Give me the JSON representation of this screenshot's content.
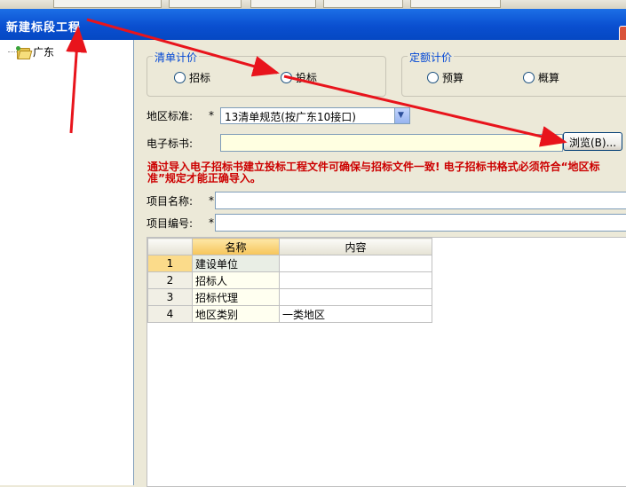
{
  "window": {
    "title": "新建标段工程"
  },
  "tree": {
    "root_label": "广东"
  },
  "pricing_group": {
    "label": "清单计价",
    "options": [
      "招标",
      "投标"
    ]
  },
  "quota_group": {
    "label": "定额计价",
    "options": [
      "预算",
      "概算"
    ]
  },
  "form": {
    "region_label": "地区标准:",
    "region_value": "13清单规范(按广东10接口)",
    "ebid_label": "电子标书:",
    "browse_label": "浏览(B)...",
    "hint": "通过导入电子招标书建立投标工程文件可确保与招标文件一致! 电子招标书格式必须符合“地区标准”规定才能正确导入。",
    "project_name_label": "项目名称:",
    "project_code_label": "项目编号:",
    "required_mark": "*"
  },
  "table": {
    "headers": [
      "名称",
      "内容"
    ],
    "rows": [
      {
        "no": "1",
        "name": "建设单位",
        "content": ""
      },
      {
        "no": "2",
        "name": "招标人",
        "content": ""
      },
      {
        "no": "3",
        "name": "招标代理",
        "content": ""
      },
      {
        "no": "4",
        "name": "地区类别",
        "content": "一类地区"
      }
    ]
  },
  "colors": {
    "titlebar": "#0a4fd0",
    "hint": "#cc0000",
    "arrow": "#e8141c",
    "group_label": "#0046d5"
  }
}
